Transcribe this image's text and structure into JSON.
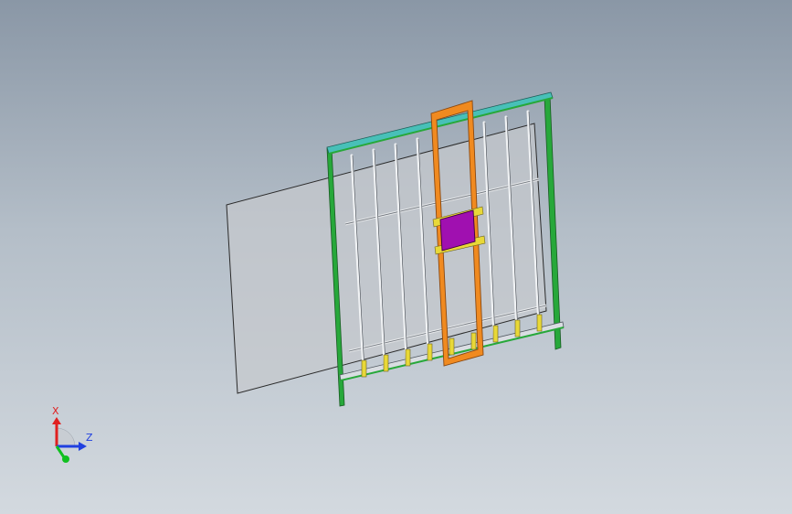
{
  "triad": {
    "x_label": "X",
    "z_label": "Z",
    "colors": {
      "x": "#e02020",
      "y": "#10c020",
      "z": "#2040e0"
    }
  },
  "model": {
    "icons": [
      "glass-panel",
      "frame",
      "gantry",
      "suction-pad"
    ],
    "colors": {
      "frame_green": "#27a83a",
      "top_rail_cyan": "#48c0b8",
      "gantry_orange": "#f08a20",
      "pad_magenta": "#a010b0",
      "support_yellow": "#e8d838",
      "glass": "#c6c9cd"
    }
  }
}
